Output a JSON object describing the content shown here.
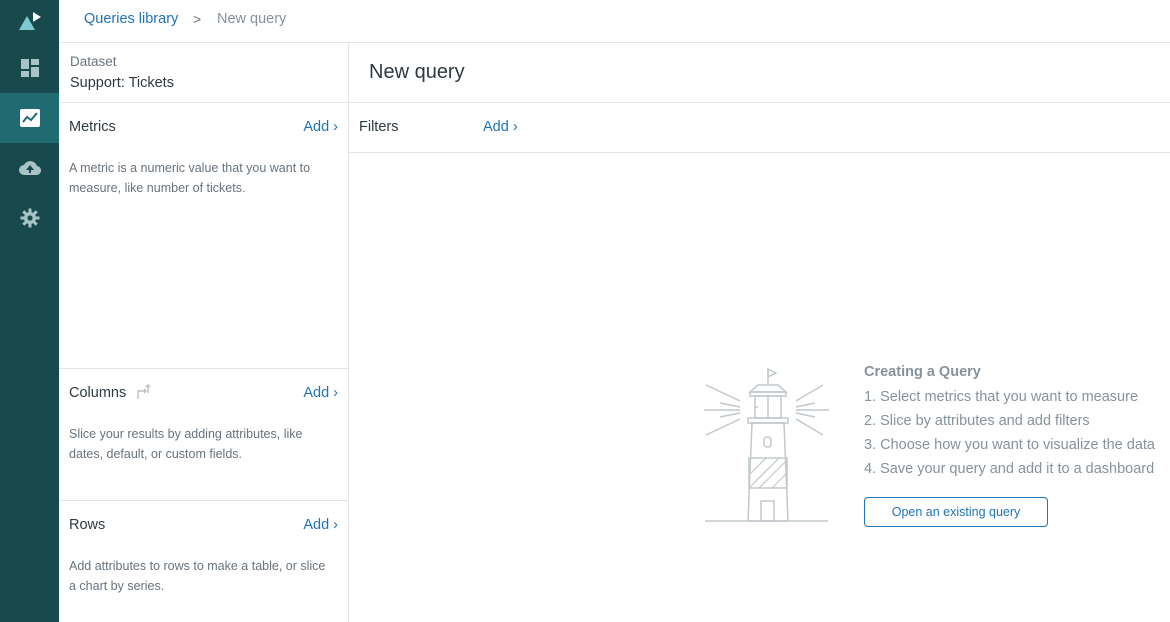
{
  "breadcrumb": {
    "link": "Queries library",
    "separator": ">",
    "current": "New query"
  },
  "dataset": {
    "label": "Dataset",
    "value": "Support: Tickets"
  },
  "sections": {
    "metrics": {
      "title": "Metrics",
      "add": "Add ›",
      "desc": "A metric is a numeric value that you want to measure, like number of tickets."
    },
    "columns": {
      "title": "Columns",
      "add": "Add ›",
      "desc": "Slice your results by adding attributes, like dates, default, or custom fields."
    },
    "rows": {
      "title": "Rows",
      "add": "Add ›",
      "desc": "Add attributes to rows to make a table, or slice a chart by series."
    }
  },
  "main": {
    "title": "New query",
    "filters_label": "Filters",
    "filters_add": "Add ›"
  },
  "guide": {
    "title": "Creating a Query",
    "steps": [
      "1. Select metrics that you want to measure",
      "2. Slice by attributes and add filters",
      "3. Choose how you want to visualize the data",
      "4. Save your query and add it to a dashboard"
    ],
    "button": "Open an existing query"
  },
  "rail": {
    "items": [
      "logo-icon",
      "dashboard-icon",
      "query-chart-icon",
      "cloud-upload-icon",
      "settings-icon"
    ],
    "active": "query-chart-icon",
    "colors": {
      "background": "#17494d",
      "active": "#1f6b71",
      "accent": "#1f73b7"
    }
  }
}
